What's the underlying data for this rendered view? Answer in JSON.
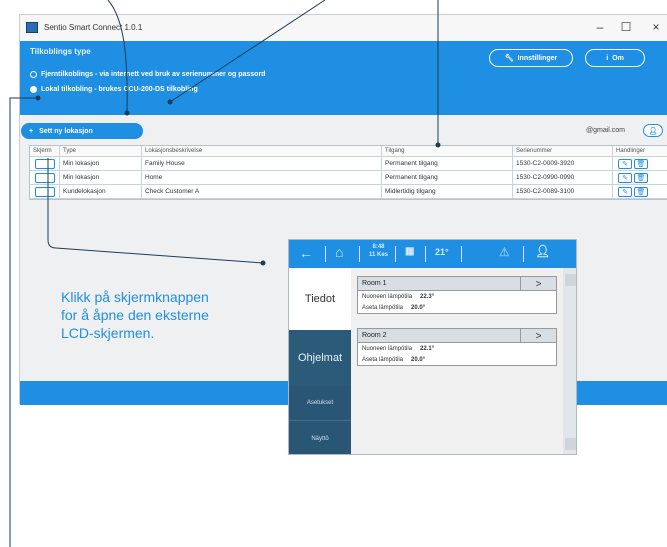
{
  "window": {
    "title": "Sentio Smart Connect 1.0.1",
    "controls": {
      "minimize": "–",
      "maximize": "☐",
      "close": "×"
    }
  },
  "connection": {
    "title": "Tilkoblings type",
    "options": [
      {
        "label": "Fjerntilkoblings - via internett ved bruk av serienummer og passord",
        "selected": false
      },
      {
        "label": "Lokal tilkobling - brukes CCU-200-DS tilkobling",
        "selected": true
      }
    ],
    "settings_button": "Innstillinger",
    "about_button": "Om"
  },
  "toolbar": {
    "add_location_button": "Sett ny lokasjon",
    "email": "@gmail.com",
    "user_button": "👤"
  },
  "table": {
    "columns": [
      "Skjerm",
      "Type",
      "Lokasjonsbeskrivelse",
      "Tilgang",
      "Serienummer",
      "Handlinger"
    ],
    "rows": [
      {
        "type": "Min lokasjon",
        "description": "Family House",
        "access": "Permanent tilgang",
        "serial": "1530-C2-0009-3920"
      },
      {
        "type": "Min lokasjon",
        "description": "Home",
        "access": "Permanent tilgang",
        "serial": "1530-C2-0990-0990"
      },
      {
        "type": "Kundelokasjon",
        "description": "Check Customer A",
        "access": "Midlertidig tilgang",
        "serial": "1530-C2-0089-3100"
      }
    ]
  },
  "callout": {
    "lines": [
      "Klikk på skjermknappen",
      "for å åpne den eksterne",
      "LCD-skjermen."
    ]
  },
  "lcd": {
    "top": {
      "time": "8:48",
      "date": "11 Kes",
      "temp": "21°"
    },
    "nav": {
      "tiedot": "Tiedot",
      "ohjelmat": "Ohjelmat",
      "asetukset": "Asetukset",
      "naytto": "Näyttö"
    },
    "rooms": [
      {
        "name": "Room 1",
        "current_label": "Nuoneen lämpötila",
        "current_value": "22.3°",
        "set_label": "Aseta lämpötila",
        "set_value": "20.0°"
      },
      {
        "name": "Room 2",
        "current_label": "Nuoneen lämpötila",
        "current_value": "22.1°",
        "set_label": "Aseta lämpötila",
        "set_value": "20.0°"
      }
    ]
  },
  "colors": {
    "accent": "#1f8fe3",
    "callout_text": "#1f8fe3",
    "lcd_sidebar": "#2c5b79"
  }
}
